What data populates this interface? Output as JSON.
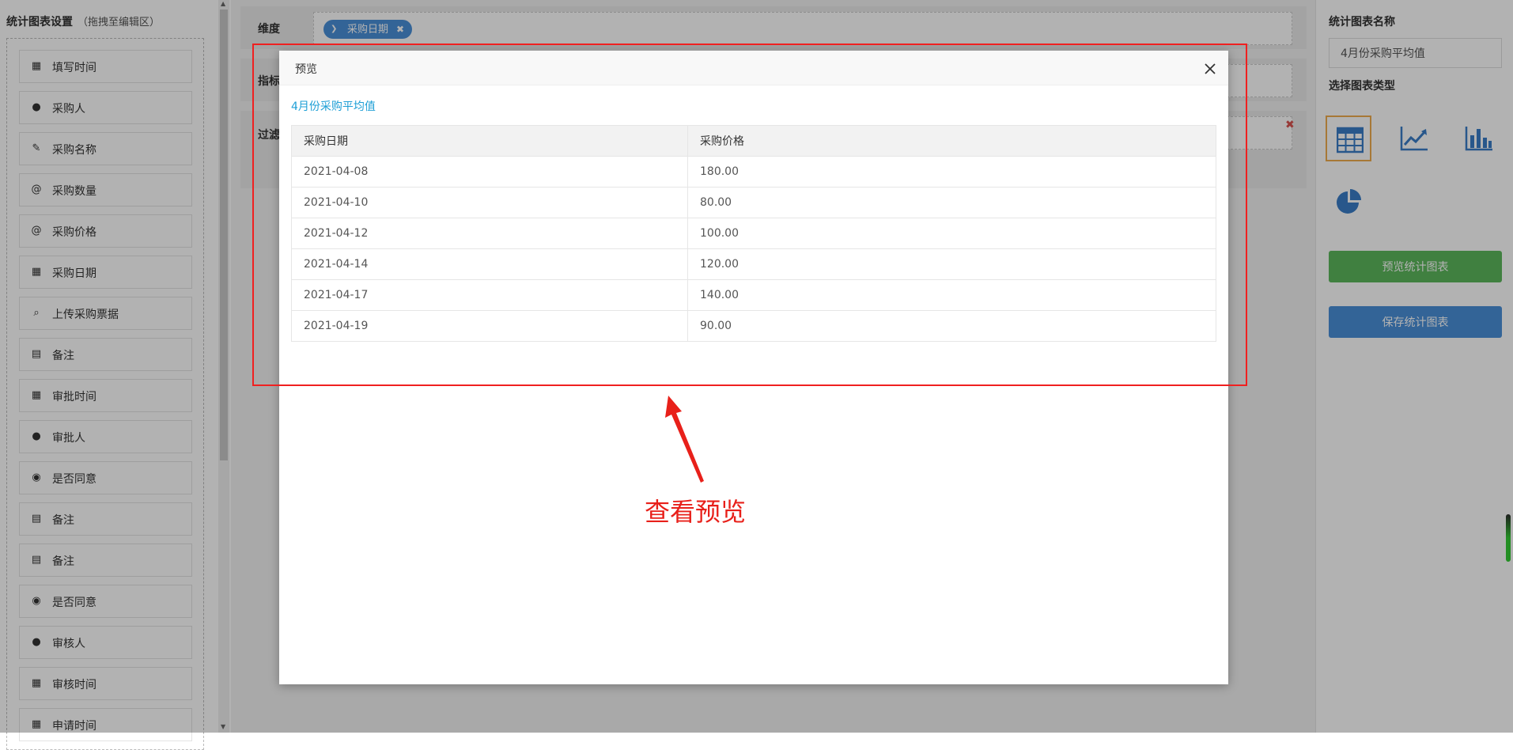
{
  "left_panel": {
    "title": "统计图表设置",
    "hint": "（拖拽至编辑区）",
    "fields": [
      {
        "label": "填写时间",
        "icon": "calendar-icon",
        "glyph": "▦"
      },
      {
        "label": "采购人",
        "icon": "user-icon",
        "glyph": "●"
      },
      {
        "label": "采购名称",
        "icon": "edit-icon",
        "glyph": "✎"
      },
      {
        "label": "采购数量",
        "icon": "at-icon",
        "glyph": "@"
      },
      {
        "label": "采购价格",
        "icon": "at-icon",
        "glyph": "@"
      },
      {
        "label": "采购日期",
        "icon": "calendar-icon",
        "glyph": "▦"
      },
      {
        "label": "上传采购票据",
        "icon": "paperclip-icon",
        "glyph": "⌕"
      },
      {
        "label": "备注",
        "icon": "document-icon",
        "glyph": "▤"
      },
      {
        "label": "审批时间",
        "icon": "calendar-icon",
        "glyph": "▦"
      },
      {
        "label": "审批人",
        "icon": "user-icon",
        "glyph": "●"
      },
      {
        "label": "是否同意",
        "icon": "radio-icon",
        "glyph": "◉"
      },
      {
        "label": "备注",
        "icon": "document-icon",
        "glyph": "▤"
      },
      {
        "label": "备注",
        "icon": "document-icon",
        "glyph": "▤"
      },
      {
        "label": "是否同意",
        "icon": "radio-icon",
        "glyph": "◉"
      },
      {
        "label": "审核人",
        "icon": "user-icon",
        "glyph": "●"
      },
      {
        "label": "审核时间",
        "icon": "calendar-icon",
        "glyph": "▦"
      },
      {
        "label": "申请时间",
        "icon": "calendar-icon",
        "glyph": "▦"
      }
    ]
  },
  "editor": {
    "dimension_label": "维度",
    "dimension_tag": "采购日期",
    "metric_label": "指标",
    "filter_label": "过滤条件"
  },
  "right_panel": {
    "chart_name_label": "统计图表名称",
    "chart_name_value": "4月份采购平均值",
    "chart_type_label": "选择图表类型",
    "chart_types": [
      {
        "name": "table-icon",
        "selected": true
      },
      {
        "name": "line-chart-icon",
        "selected": false
      },
      {
        "name": "bar-chart-icon",
        "selected": false
      },
      {
        "name": "pie-chart-icon",
        "selected": false
      }
    ],
    "preview_button": "预览统计图表",
    "save_button": "保存统计图表",
    "colors": {
      "preview": "#5cb85c",
      "save": "#4a90d9",
      "selected_border": "#f0ad4e"
    }
  },
  "modal": {
    "title": "预览",
    "chart_title": "4月份采购平均值",
    "columns": [
      "采购日期",
      "采购价格"
    ],
    "rows": [
      [
        "2021-04-08",
        "180.00"
      ],
      [
        "2021-04-10",
        "80.00"
      ],
      [
        "2021-04-12",
        "100.00"
      ],
      [
        "2021-04-14",
        "120.00"
      ],
      [
        "2021-04-17",
        "140.00"
      ],
      [
        "2021-04-19",
        "90.00"
      ]
    ]
  },
  "annotation": {
    "text": "查看预览",
    "color": "#e8201a"
  }
}
